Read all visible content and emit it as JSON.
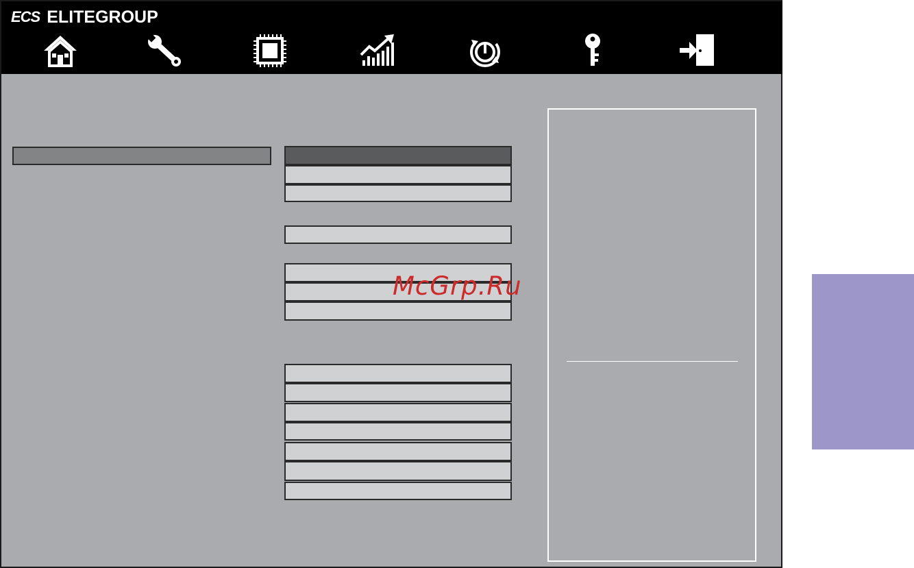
{
  "header": {
    "brand_mark": "ECS",
    "brand_name": "ELITEGROUP"
  },
  "nav": [
    {
      "icon": "home-icon"
    },
    {
      "icon": "wrench-icon"
    },
    {
      "icon": "chip-icon"
    },
    {
      "icon": "performance-chart-icon"
    },
    {
      "icon": "power-icon"
    },
    {
      "icon": "key-icon"
    },
    {
      "icon": "exit-icon"
    }
  ],
  "colors": {
    "background": "#aaabaf",
    "topbar": "#000000",
    "field": "#d0d1d3",
    "field_active": "#5a5b5d",
    "side_tab": "#9d97c9",
    "watermark": "#cc2b2b"
  },
  "watermark": "McGrp.Ru"
}
